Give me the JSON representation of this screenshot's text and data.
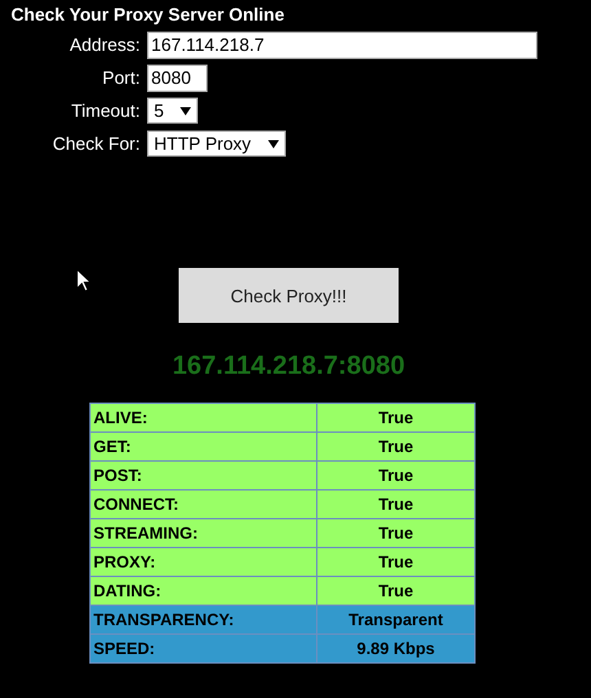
{
  "title": "Check Your Proxy Server Online",
  "form": {
    "address": {
      "label": "Address:",
      "value": "167.114.218.7"
    },
    "port": {
      "label": "Port:",
      "value": "8080"
    },
    "timeout": {
      "label": "Timeout:",
      "value": "5"
    },
    "check_for": {
      "label": "Check For:",
      "value": "HTTP Proxy"
    }
  },
  "button": "Check Proxy!!!",
  "result_heading": "167.114.218.7:8080",
  "results": [
    {
      "name": "ALIVE:",
      "value": "True",
      "color": "#99ff66"
    },
    {
      "name": "GET:",
      "value": "True",
      "color": "#99ff66"
    },
    {
      "name": "POST:",
      "value": "True",
      "color": "#99ff66"
    },
    {
      "name": "CONNECT:",
      "value": "True",
      "color": "#99ff66"
    },
    {
      "name": "STREAMING:",
      "value": "True",
      "color": "#99ff66"
    },
    {
      "name": "PROXY:",
      "value": "True",
      "color": "#99ff66"
    },
    {
      "name": "DATING:",
      "value": "True",
      "color": "#99ff66"
    },
    {
      "name": "TRANSPARENCY:",
      "value": "Transparent",
      "color": "#3399cc"
    },
    {
      "name": "SPEED:",
      "value": "9.89 Kbps",
      "color": "#3399cc"
    }
  ]
}
